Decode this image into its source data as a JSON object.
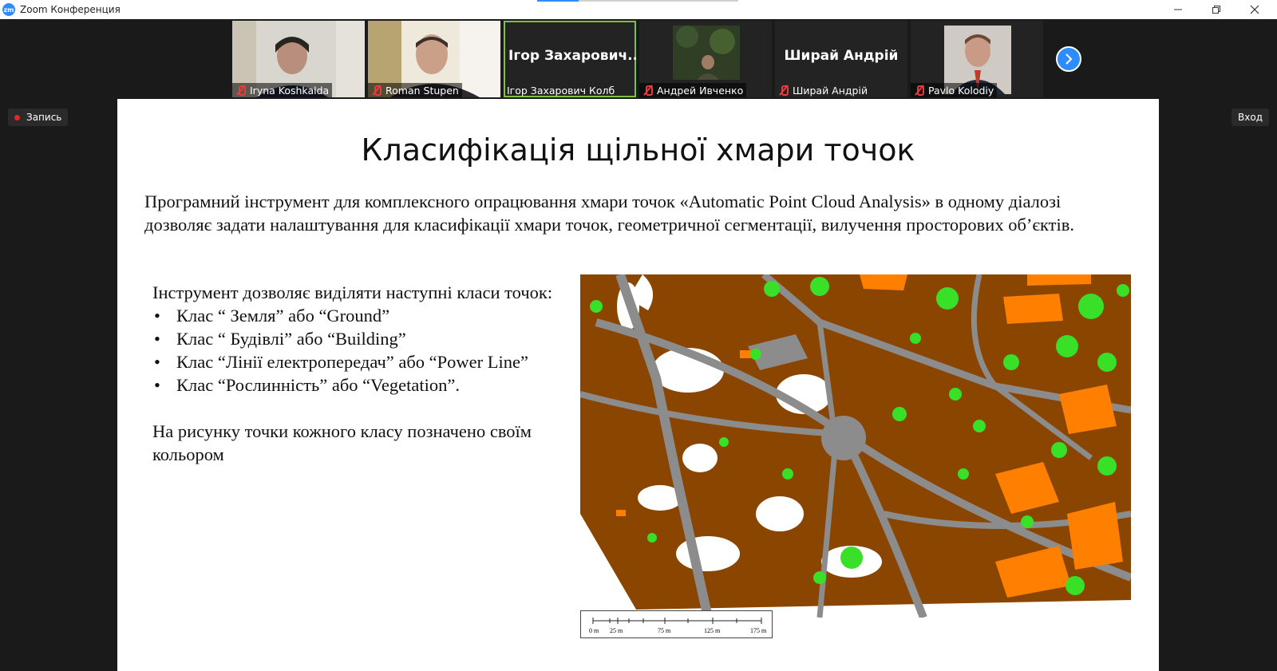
{
  "window": {
    "logo": "zm",
    "title": "Zoom Конференция",
    "controls": [
      "minimize-icon",
      "restore-icon",
      "close-icon"
    ]
  },
  "participants": [
    {
      "name": "Iryna Koshkalda",
      "muted": true,
      "video": true
    },
    {
      "name": "Roman Stupen",
      "muted": true,
      "video": true
    },
    {
      "name": "Ігор Захарович Колб",
      "display": "Ігор Захарович...",
      "muted": false,
      "video": false,
      "active_speaker": true
    },
    {
      "name": "Андрей Ивченко",
      "muted": true,
      "video": true
    },
    {
      "name": "Ширай Андрій",
      "display": "Ширай Андрій",
      "muted": true,
      "video": false
    },
    {
      "name": "Pavlo Kolodiy",
      "muted": true,
      "video": true
    }
  ],
  "overlays": {
    "recording_label": "Запись",
    "enter_label": "Вход"
  },
  "slide": {
    "title": "Класифікація щільної хмари точок",
    "intro": "Програмний інструмент для комплексного опрацювання хмари точок «Automatic Point Cloud Analysis» в одному діалозі дозволяє задати налаштування для класифікації хмари точок, геометричної сегментації, вилучення просторових об’єктів.",
    "list_heading": "Інструмент дозволяє виділяти наступні класи точок:",
    "classes": [
      "Клас “ Земля” або “Ground”",
      "Клас “ Будівлі” або “Building”",
      "Клас “Лінії електропередач” або “Power Line”",
      "Клас “Рослинність” або “Vegetation”."
    ],
    "note": "На рисунку точки кожного класу позначено своїм кольором",
    "scalebar_labels": [
      "0 m",
      "25 m",
      "75 m",
      "125 m",
      "175 m"
    ],
    "map_colors": {
      "ground": "#8a4500",
      "building": "#ff8000",
      "vegetation": "#38e028",
      "other": "#8c8c8c"
    }
  },
  "colors": {
    "accent": "#2d8cff",
    "active_speaker_border": "#7fc241",
    "recording_dot": "#e02828"
  }
}
